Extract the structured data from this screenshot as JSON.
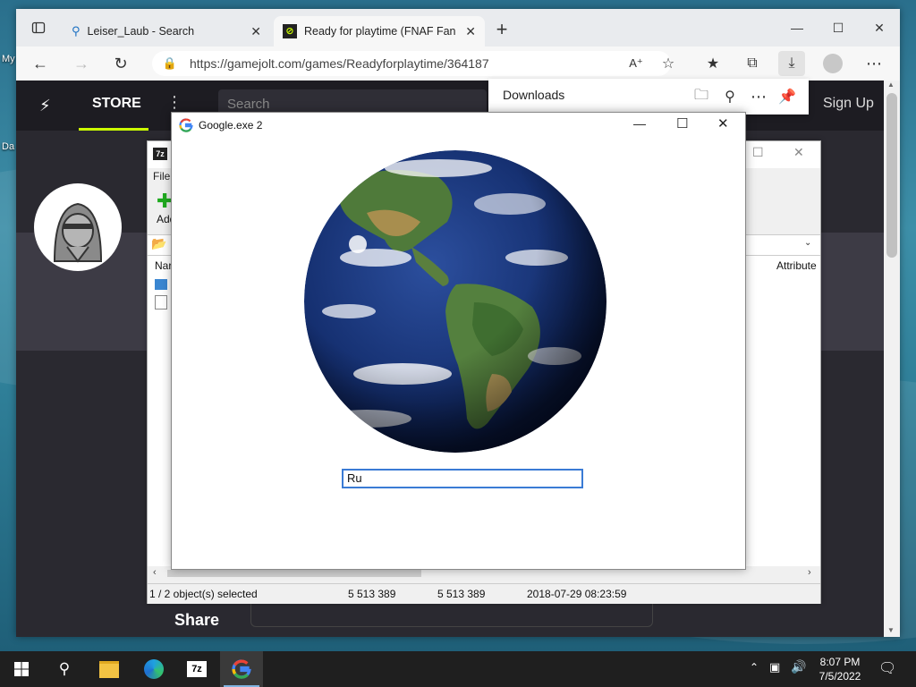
{
  "desktop": {
    "labels": [
      "My",
      "Da"
    ]
  },
  "browser": {
    "tabs": [
      {
        "title": "Leiser_Laub - Search",
        "icon": "search-icon",
        "active": false
      },
      {
        "title": "Ready for playtime (FNAF Fan Ga",
        "icon": "gamejolt-icon",
        "active": true
      }
    ],
    "new_tab": "+",
    "url": "https://gamejolt.com/games/Readyforplaytime/364187"
  },
  "site": {
    "nav_store": "STORE",
    "search_placeholder": "Search",
    "sign_up": "Sign Up",
    "share": "Share"
  },
  "downloads": {
    "title": "Downloads"
  },
  "sevenzip": {
    "menu_file": "File",
    "toolbar_add": "Add",
    "columns": {
      "name": "Nar",
      "attributes": "Attribute"
    },
    "status": {
      "selected": "1 / 2 object(s) selected",
      "size": "5 513 389",
      "packed": "5 513 389",
      "modified": "2018-07-29 08:23:59"
    }
  },
  "google_window": {
    "title": "Google.exe 2",
    "input_value": "Ru"
  },
  "taskbar": {
    "time": "8:07 PM",
    "date": "7/5/2022"
  },
  "colors": {
    "accent": "#ccff00",
    "site_bg": "#2a2930",
    "input_focus": "#3a7bd5"
  }
}
